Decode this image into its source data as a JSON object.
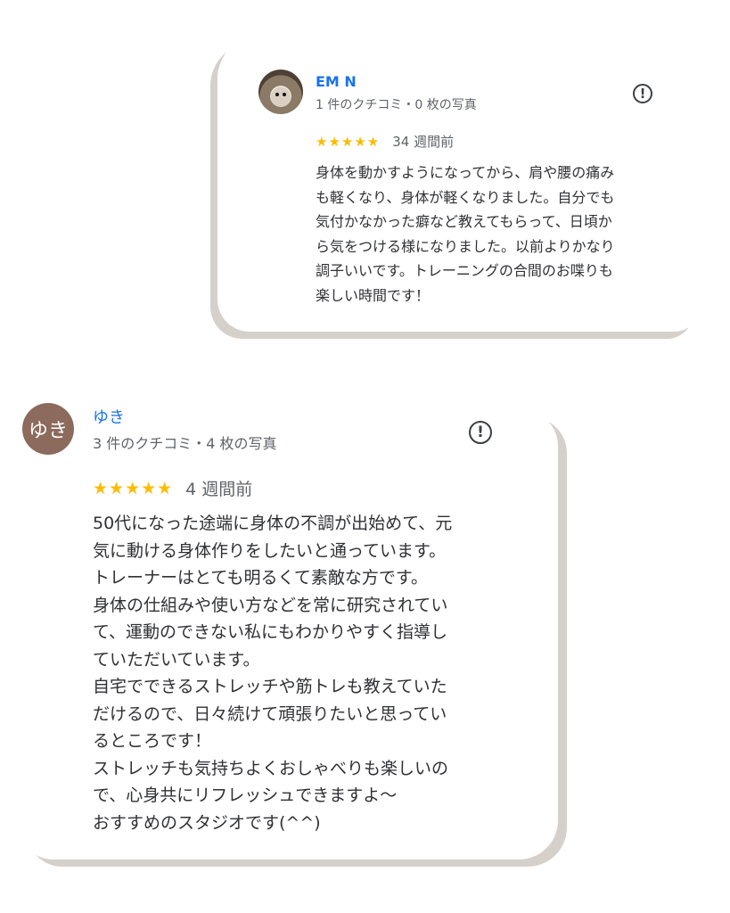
{
  "reviews": [
    {
      "name": "EM N",
      "meta": "1 件のクチコミ・0 枚の写真",
      "stars": "★★★★★",
      "time": "34 週間前",
      "text": "身体を動かすようになってから、肩や腰の痛み\nも軽くなり、身体が軽くなりました。自分でも\n気付かなかった癖など教えてもらって、日頃か\nら気をつける様になりました。以前よりかなり\n調子いいです。トレーニングの合間のお喋りも\n楽しい時間です！"
    },
    {
      "avatar_letter": "ゆき",
      "name": "ゆき",
      "meta": "3 件のクチコミ・4 枚の写真",
      "stars": "★★★★★",
      "time": "4 週間前",
      "text": "50代になった途端に身体の不調が出始めて、元\n気に動ける身体作りをしたいと通っています。\nトレーナーはとても明るくて素敵な方です。\n身体の仕組みや使い方などを常に研究されてい\nて、運動のできない私にもわかりやすく指導し\nていただいています。\n自宅でできるストレッチや筋トレも教えていた\nだけるので、日々続けて頑張りたいと思ってい\nるところです！\nストレッチも気持ちよくおしゃべりも楽しいの\nで、心身共にリフレッシュできますよ〜\nおすすめのスタジオです(^^)"
    }
  ],
  "icons": {
    "flag": "report-flag-icon",
    "avatar_photo": "hedgehog-avatar"
  },
  "colors": {
    "name": "#1a73e8",
    "star": "#fbbc04",
    "card_shadow": "#d6d0cb",
    "avatar_bg": "#8c6a5c"
  }
}
